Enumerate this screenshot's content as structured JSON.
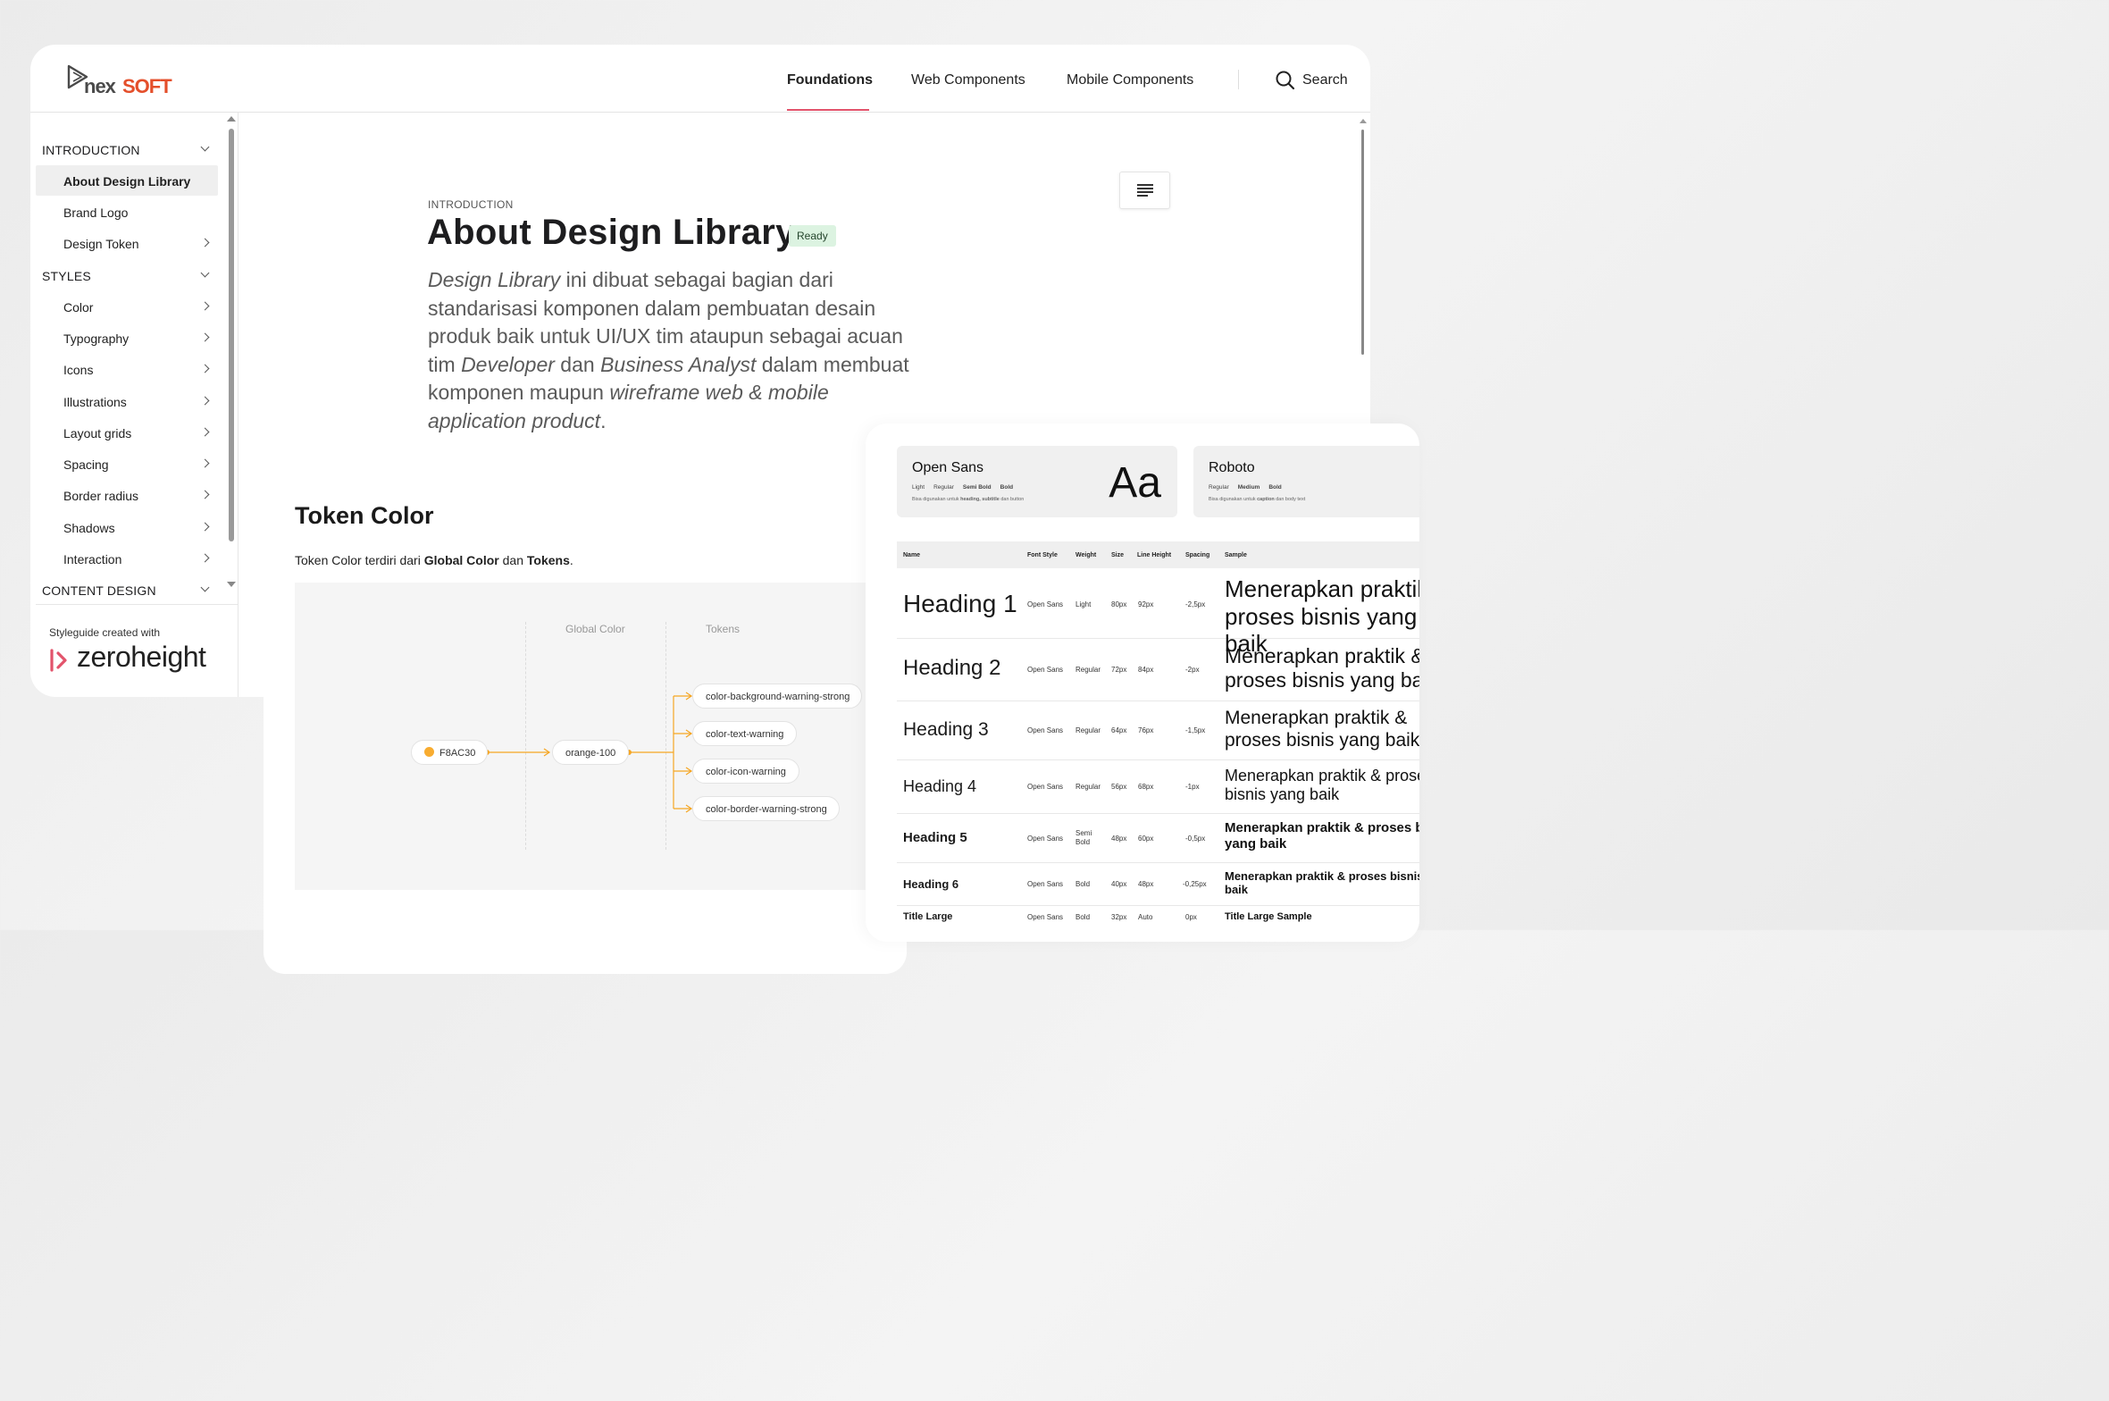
{
  "brand": {
    "logo_part1": "nex",
    "logo_part2": "SOFT"
  },
  "nav": {
    "items": [
      {
        "label": "Foundations",
        "active": true
      },
      {
        "label": "Web Components",
        "active": false
      },
      {
        "label": "Mobile Components",
        "active": false
      }
    ],
    "search_label": "Search"
  },
  "sidebar": {
    "sections": [
      {
        "title": "INTRODUCTION",
        "items": [
          "About Design Library",
          "Brand Logo",
          "Design Token"
        ]
      },
      {
        "title": "STYLES",
        "items": [
          "Color",
          "Typography",
          "Icons",
          "Illustrations",
          "Layout grids",
          "Spacing",
          "Border radius",
          "Shadows",
          "Interaction"
        ]
      },
      {
        "title": "CONTENT DESIGN",
        "items": []
      }
    ],
    "active_item": "About Design Library",
    "footer_caption": "Styleguide created with",
    "footer_brand": "zeroheight"
  },
  "page": {
    "eyebrow": "INTRODUCTION",
    "title": "About Design Library",
    "status_badge": "Ready",
    "description": {
      "p1": "Design Library",
      "p2": " ini dibuat sebagai bagian dari standarisasi komponen dalam pembuatan desain produk baik untuk UI/UX tim ataupun sebagai acuan tim ",
      "p3": "Developer",
      "p4": " dan ",
      "p5": "Business Analyst",
      "p6": " dalam membuat komponen maupun ",
      "p7": "wireframe web & mobile application product",
      "p8": "."
    }
  },
  "token_card": {
    "title": "Token Color",
    "desc_prefix": "Token Color terdiri dari ",
    "desc_b1": "Global Color",
    "desc_mid": " dan ",
    "desc_b2": "Tokens",
    "desc_suffix": ".",
    "diagram": {
      "col_global": "Global Color",
      "col_tokens": "Tokens",
      "source_hex": "F8AC30",
      "source_color": "#F8AC30",
      "global_token": "orange-100",
      "tokens": [
        "color-background-warning-strong",
        "color-text-warning",
        "color-icon-warning",
        "color-border-warning-strong"
      ],
      "connector_color": "#F5A623"
    }
  },
  "typography_card": {
    "fonts": [
      {
        "name": "Open Sans",
        "weights": [
          "Light",
          "Regular",
          "Semi Bold",
          "Bold"
        ],
        "usage_pre": "Bisa digunakan untuk ",
        "usage_bold": "heading, subtitle",
        "usage_post": " dan button",
        "preview": "Aa"
      },
      {
        "name": "Roboto",
        "weights": [
          "Regular",
          "Medium",
          "Bold"
        ],
        "usage_pre": "Bisa digunakan untuk ",
        "usage_bold": "caption",
        "usage_post": " dan body text",
        "preview": ""
      }
    ],
    "columns": [
      "Name",
      "Font Style",
      "Weight",
      "Size",
      "Line Height",
      "Spacing",
      "Sample"
    ],
    "rows": [
      {
        "name": "Heading 1",
        "style": "Open Sans",
        "weight": "Light",
        "size": "80px",
        "line_height": "92px",
        "spacing": "-2,5px",
        "sample": "Menerapkan praktik & proses bisnis yang baik"
      },
      {
        "name": "Heading 2",
        "style": "Open Sans",
        "weight": "Regular",
        "size": "72px",
        "line_height": "84px",
        "spacing": "-2px",
        "sample": "Menerapkan praktik & proses bisnis yang baik"
      },
      {
        "name": "Heading 3",
        "style": "Open Sans",
        "weight": "Regular",
        "size": "64px",
        "line_height": "76px",
        "spacing": "-1,5px",
        "sample": "Menerapkan praktik & proses bisnis yang baik"
      },
      {
        "name": "Heading 4",
        "style": "Open Sans",
        "weight": "Regular",
        "size": "56px",
        "line_height": "68px",
        "spacing": "-1px",
        "sample": "Menerapkan praktik & proses bisnis yang baik"
      },
      {
        "name": "Heading 5",
        "style": "Open Sans",
        "weight": "Semi Bold",
        "size": "48px",
        "line_height": "60px",
        "spacing": "-0,5px",
        "sample": "Menerapkan praktik & proses bisnis yang baik"
      },
      {
        "name": "Heading 6",
        "style": "Open Sans",
        "weight": "Bold",
        "size": "40px",
        "line_height": "48px",
        "spacing": "-0,25px",
        "sample": "Menerapkan praktik & proses bisnis yang baik"
      },
      {
        "name": "Title Large",
        "style": "Open Sans",
        "weight": "Bold",
        "size": "32px",
        "line_height": "Auto",
        "spacing": "0px",
        "sample": "Title Large Sample"
      }
    ]
  },
  "colors": {
    "accent": "#E2536B",
    "brand_orange": "#E44F2B",
    "ready_bg": "#DCF3E1",
    "zeroheight_pink": "#E2536B"
  }
}
